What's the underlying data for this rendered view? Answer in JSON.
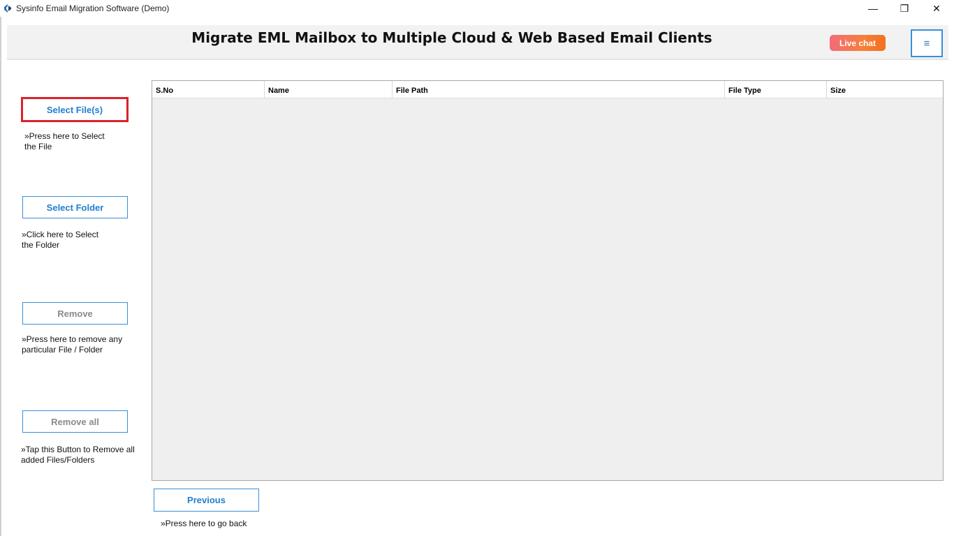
{
  "window": {
    "title": "Sysinfo Email Migration Software (Demo)",
    "minimize_glyph": "—",
    "maximize_glyph": "❐",
    "close_glyph": "✕"
  },
  "header": {
    "title": "Migrate EML Mailbox to Multiple Cloud & Web Based Email Clients",
    "live_chat_label": "Live chat",
    "menu_glyph": "≡"
  },
  "sidebar": {
    "select_files": {
      "label": "Select File(s)",
      "hint": "»Press here to Select\nthe File"
    },
    "select_folder": {
      "label": "Select Folder",
      "hint": "»Click here to Select\nthe Folder"
    },
    "remove": {
      "label": "Remove",
      "hint": "»Press here to remove any\nparticular File / Folder"
    },
    "remove_all": {
      "label": "Remove all",
      "hint": "»Tap this Button to Remove all\nadded Files/Folders"
    }
  },
  "table": {
    "columns": [
      "S.No",
      "Name",
      "File Path",
      "File Type",
      "Size"
    ],
    "rows": []
  },
  "footer": {
    "previous_label": "Previous",
    "previous_hint": "»Press here to go back"
  },
  "colors": {
    "accent_blue": "#1f7fd0",
    "highlight_red": "#d9232d",
    "live_chat_orange": "#f5701f"
  }
}
